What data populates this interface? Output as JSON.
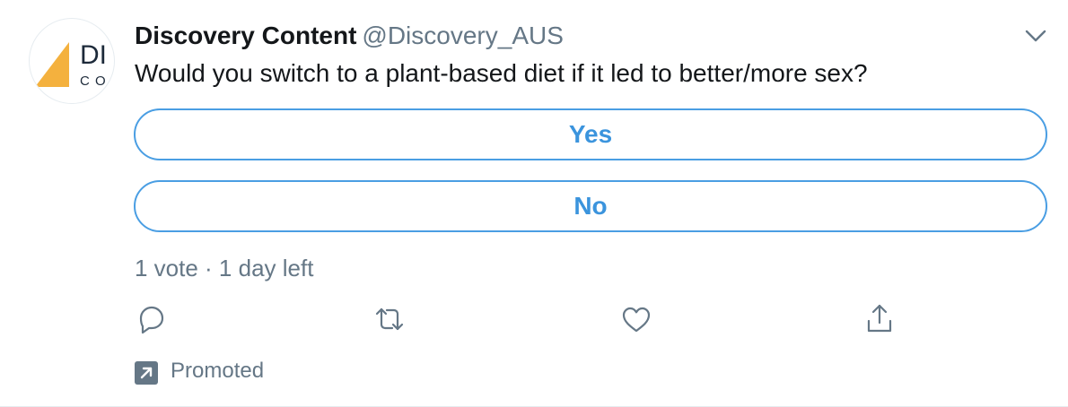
{
  "tweet": {
    "display_name": "Discovery Content",
    "handle": "@Discovery_AUS",
    "text": "Would you switch to a plant-based diet if it led to better/more sex?",
    "avatar": {
      "logo_text_top": "DI",
      "logo_text_bottom": "C O",
      "accent_color": "#f4b13e"
    }
  },
  "poll": {
    "options": [
      {
        "label": "Yes"
      },
      {
        "label": "No"
      }
    ],
    "meta": "1 vote · 1 day left"
  },
  "actions": {
    "icons": [
      "reply-icon",
      "retweet-icon",
      "like-icon",
      "share-icon"
    ]
  },
  "promoted": {
    "label": "Promoted",
    "icon": "promoted-arrow-icon"
  },
  "colors": {
    "accent": "#3b94dd",
    "secondary_text": "#657786",
    "primary_text": "#14171a"
  }
}
